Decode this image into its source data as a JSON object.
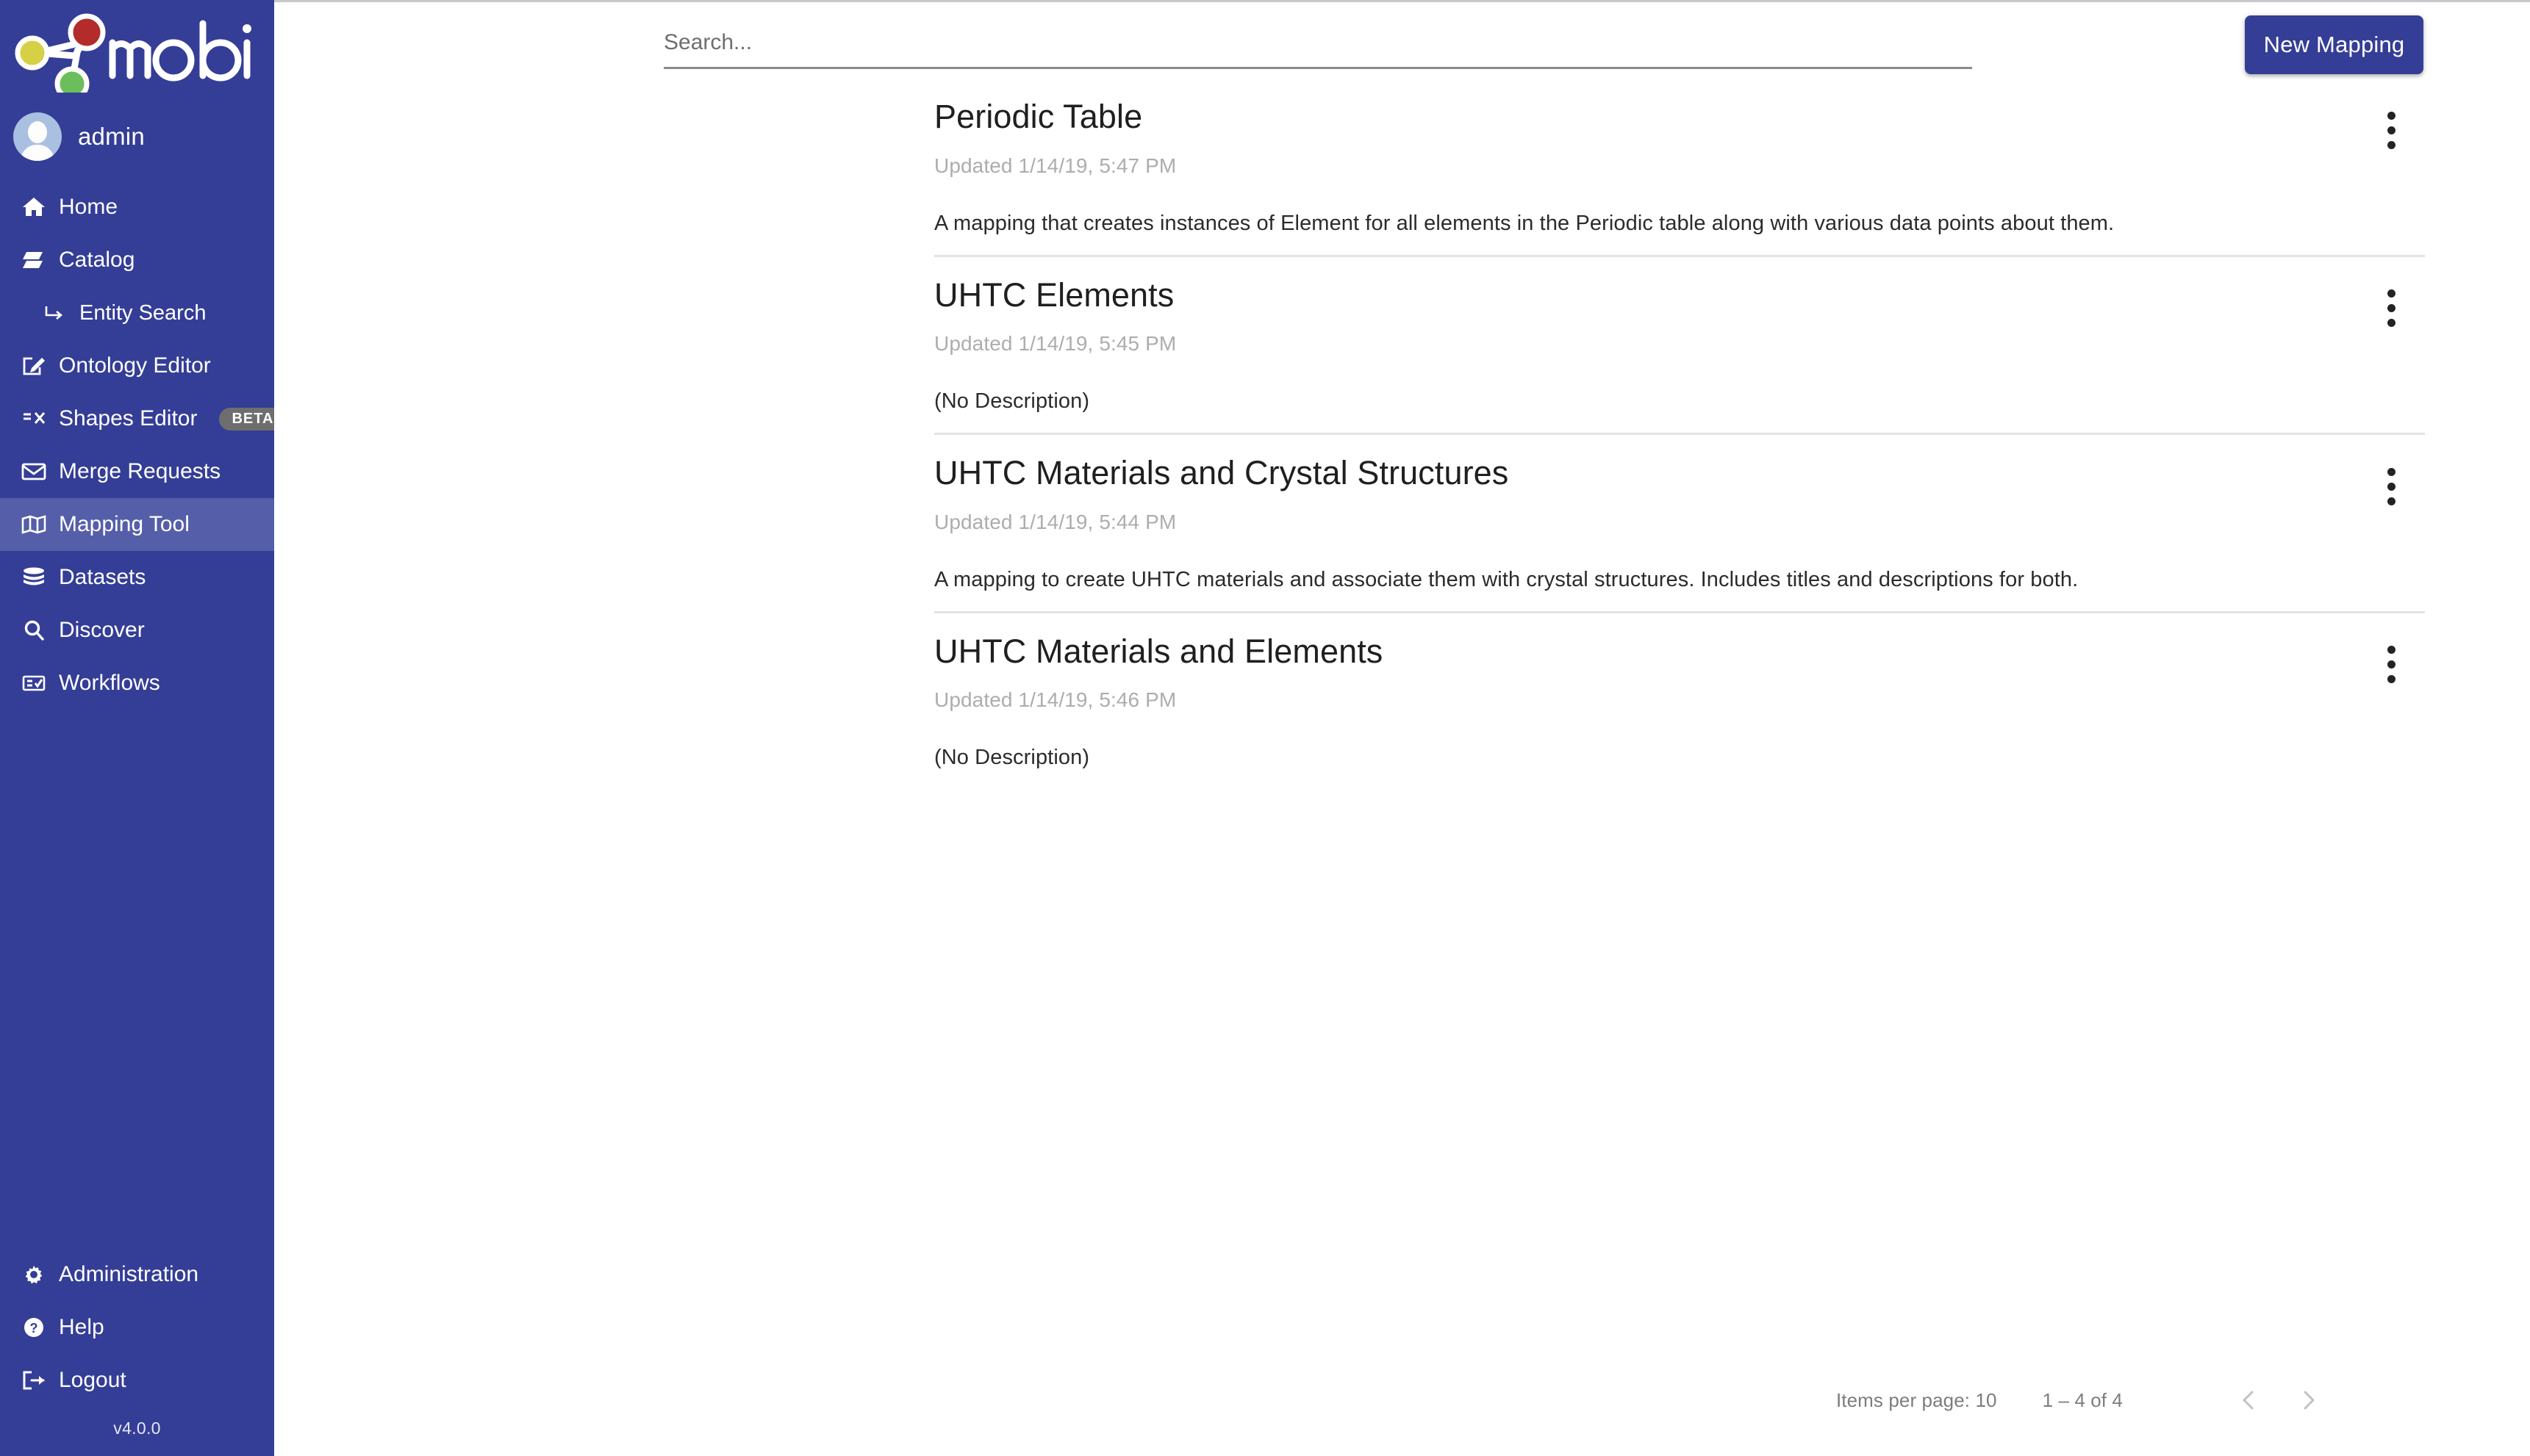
{
  "brand": {
    "name": "mobi",
    "logo_colors": {
      "red": "#b42b2b",
      "yellow": "#d6d047",
      "green": "#6cbe5a",
      "white": "#ffffff"
    }
  },
  "theme": {
    "sidebar_bg": "#343e96",
    "sidebar_active_bg": "#555ea8",
    "accent": "#343e96",
    "badge_bg": "#6e6e6e",
    "muted_text": "#adadad",
    "divider": "#e3e3e3"
  },
  "user": {
    "name": "admin"
  },
  "sidebar": {
    "items": [
      {
        "label": "Home",
        "icon": "home-icon",
        "active": false,
        "sub": false
      },
      {
        "label": "Catalog",
        "icon": "book-icon",
        "active": false,
        "sub": false
      },
      {
        "label": "Entity Search",
        "icon": "arrow-turn-icon",
        "active": false,
        "sub": true
      },
      {
        "label": "Ontology Editor",
        "icon": "pencil-square-icon",
        "active": false,
        "sub": false
      },
      {
        "label": "Shapes Editor",
        "icon": "shapes-icon",
        "active": false,
        "sub": false,
        "badge": "BETA"
      },
      {
        "label": "Merge Requests",
        "icon": "envelope-icon",
        "active": false,
        "sub": false
      },
      {
        "label": "Mapping Tool",
        "icon": "map-icon",
        "active": true,
        "sub": false
      },
      {
        "label": "Datasets",
        "icon": "database-icon",
        "active": false,
        "sub": false
      },
      {
        "label": "Discover",
        "icon": "magnifier-icon",
        "active": false,
        "sub": false
      },
      {
        "label": "Workflows",
        "icon": "workflow-icon",
        "active": false,
        "sub": false
      }
    ],
    "bottom_items": [
      {
        "label": "Administration",
        "icon": "gear-icon"
      },
      {
        "label": "Help",
        "icon": "question-circle-icon"
      },
      {
        "label": "Logout",
        "icon": "logout-icon"
      }
    ],
    "version": "v4.0.0"
  },
  "toolbar": {
    "search_value": "",
    "search_placeholder": "Search...",
    "new_mapping_label": "New Mapping"
  },
  "mappings": [
    {
      "title": "Periodic Table",
      "updated": "Updated 1/14/19, 5:47 PM",
      "description": "A mapping that creates instances of Element for all elements in the Periodic table along with various data points about them."
    },
    {
      "title": "UHTC Elements",
      "updated": "Updated 1/14/19, 5:45 PM",
      "description": "(No Description)"
    },
    {
      "title": "UHTC Materials and Crystal Structures",
      "updated": "Updated 1/14/19, 5:44 PM",
      "description": "A mapping to create UHTC materials and associate them with crystal structures. Includes titles and descriptions for both."
    },
    {
      "title": "UHTC Materials and Elements",
      "updated": "Updated 1/14/19, 5:46 PM",
      "description": "(No Description)"
    }
  ],
  "paginator": {
    "items_per_page_label": "Items per page: 10",
    "range_label": "1 – 4 of 4"
  }
}
